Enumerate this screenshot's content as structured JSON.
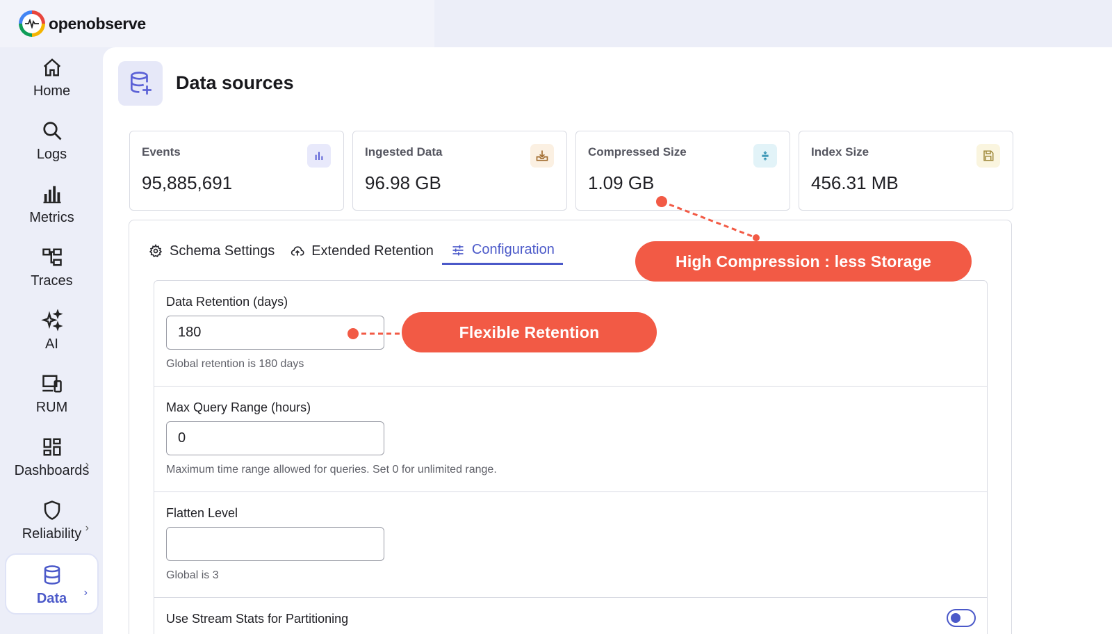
{
  "app": {
    "logo_text": "openobserve"
  },
  "sidebar": {
    "items": [
      {
        "label": "Home",
        "icon": "home-icon"
      },
      {
        "label": "Logs",
        "icon": "search-icon"
      },
      {
        "label": "Metrics",
        "icon": "bar-chart-icon"
      },
      {
        "label": "Traces",
        "icon": "traces-icon"
      },
      {
        "label": "AI",
        "icon": "sparkle-icon"
      },
      {
        "label": "RUM",
        "icon": "devices-icon"
      },
      {
        "label": "Dashboards",
        "icon": "dashboard-grid-icon"
      },
      {
        "label": "Reliability",
        "icon": "shield-icon"
      },
      {
        "label": "Data",
        "icon": "database-icon",
        "active": true
      }
    ]
  },
  "header": {
    "title": "Data sources"
  },
  "stats": [
    {
      "label": "Events",
      "value": "95,885,691",
      "icon": "bar-chart-icon",
      "color": "#5b61d6"
    },
    {
      "label": "Ingested Data",
      "value": "96.98 GB",
      "icon": "download-tray-icon",
      "color": "#a06a2c"
    },
    {
      "label": "Compressed Size",
      "value": "1.09 GB",
      "icon": "compress-icon",
      "color": "#2d8fb0"
    },
    {
      "label": "Index Size",
      "value": "456.31 MB",
      "icon": "save-icon",
      "color": "#a08a3c"
    }
  ],
  "tabs": [
    {
      "label": "Schema Settings",
      "icon": "gear-icon"
    },
    {
      "label": "Extended Retention",
      "icon": "cloud-upload-icon"
    },
    {
      "label": "Configuration",
      "icon": "sliders-icon",
      "active": true
    }
  ],
  "form": {
    "retention": {
      "label": "Data Retention (days)",
      "value": "180",
      "hint": "Global retention is 180 days"
    },
    "max_query": {
      "label": "Max Query Range (hours)",
      "value": "0",
      "hint": "Maximum time range allowed for queries. Set 0 for unlimited range."
    },
    "flatten": {
      "label": "Flatten Level",
      "value": "",
      "hint": "Global is 3"
    },
    "stream_stats": {
      "label": "Use Stream Stats for Partitioning",
      "enabled": true
    }
  },
  "callouts": {
    "compression": "High Compression : less Storage",
    "retention": "Flexible Retention"
  },
  "colors": {
    "accent": "#4b59c9",
    "callout": "#f25a45"
  }
}
